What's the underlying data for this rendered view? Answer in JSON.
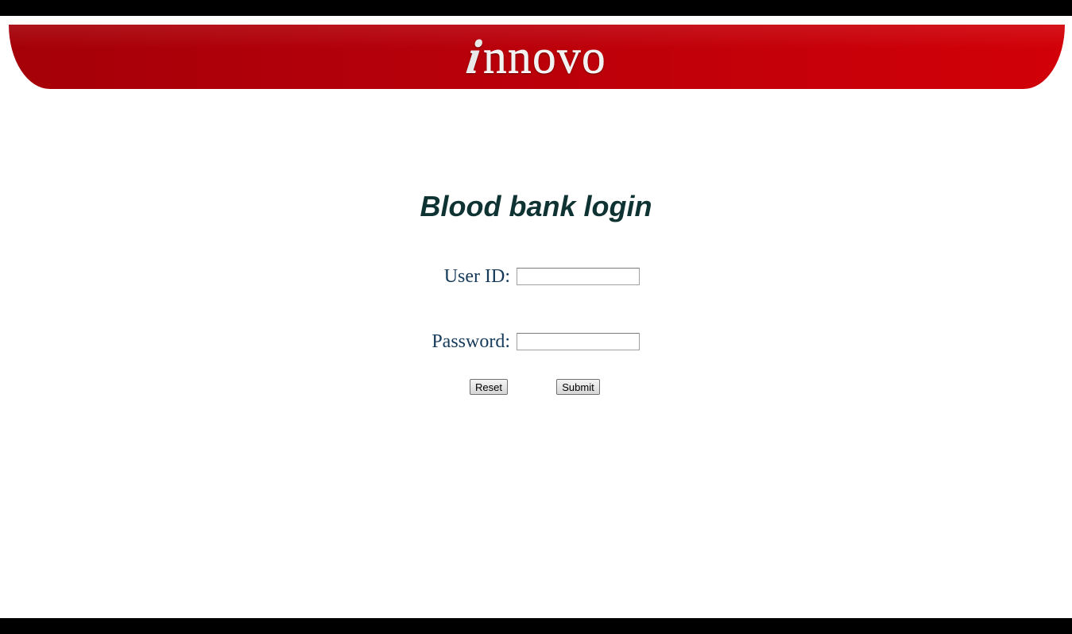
{
  "banner": {
    "logo_initial": "i",
    "logo_rest": "nnovo",
    "brand_color": "#c00008"
  },
  "form": {
    "title": "Blood bank login",
    "user_id_label": "User ID:",
    "user_id_value": "",
    "password_label": "Password:",
    "password_value": "",
    "reset_label": "Reset",
    "submit_label": "Submit"
  },
  "colors": {
    "title": "#0f3333",
    "label": "#163a5a",
    "frame": "#000000"
  }
}
